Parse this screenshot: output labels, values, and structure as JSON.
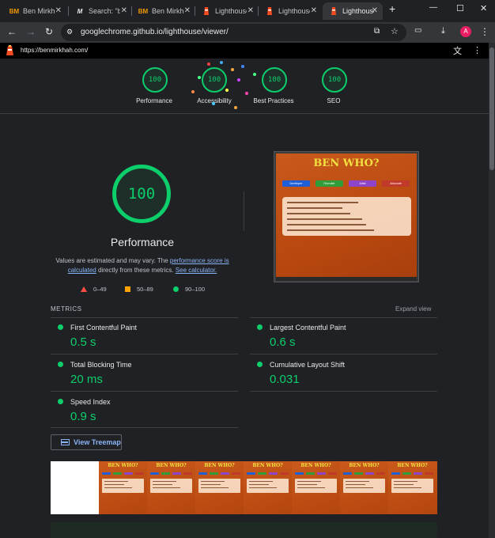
{
  "browser": {
    "tabs": [
      {
        "favicon": "BM",
        "title": "Ben Mirkhah",
        "active": false
      },
      {
        "favicon": "M",
        "title": "Search: \"b",
        "active": false
      },
      {
        "favicon": "BM",
        "title": "Ben Mirkh",
        "active": false
      },
      {
        "favicon": "lighthouse-icon",
        "title": "Lighthouse",
        "active": false
      },
      {
        "favicon": "lighthouse-icon",
        "title": "Lighthouse",
        "active": false
      },
      {
        "favicon": "lighthouse-icon",
        "title": "Lighthouse",
        "active": true
      }
    ],
    "new_tab": "+",
    "window_controls": {
      "minimize": "—",
      "maximize": "☐",
      "close": "✕"
    },
    "address": "googlechrome.github.io/lighthouse/viewer/",
    "profile_initial": "A",
    "accent_color": "#e91e63"
  },
  "lighthouse": {
    "report_url": "https://benmirkhah.com/",
    "summary_gauges": [
      {
        "label": "Performance",
        "score": "100"
      },
      {
        "label": "Accessibility",
        "score": "100"
      },
      {
        "label": "Best Practices",
        "score": "100"
      },
      {
        "label": "SEO",
        "score": "100"
      }
    ],
    "performance": {
      "score": "100",
      "title": "Performance",
      "note_prefix": "Values are estimated and may vary. The ",
      "note_link1": "performance score is calculated",
      "note_mid": " directly from these metrics. ",
      "note_link2": "See calculator.",
      "legend": [
        {
          "range": "0–49",
          "color": "#ff4e42",
          "shape": "triangle"
        },
        {
          "range": "50–89",
          "color": "#ffa400",
          "shape": "square"
        },
        {
          "range": "90–100",
          "color": "#0cce6b",
          "shape": "circle"
        }
      ]
    },
    "screenshot": {
      "site_title": "BEN WHO?",
      "buttons": [
        {
          "label": "Developer",
          "color": "#1e5fd8"
        },
        {
          "label": "Recruiter",
          "color": "#2f9e3a"
        },
        {
          "label": "Artist",
          "color": "#8e44c9"
        },
        {
          "label": "Advocate",
          "color": "#c0392b"
        }
      ]
    },
    "metrics_header": "METRICS",
    "expand_view": "Expand view",
    "metrics": [
      {
        "name": "First Contentful Paint",
        "value": "0.5 s"
      },
      {
        "name": "Largest Contentful Paint",
        "value": "0.6 s"
      },
      {
        "name": "Total Blocking Time",
        "value": "20 ms"
      },
      {
        "name": "Cumulative Layout Shift",
        "value": "0.031"
      },
      {
        "name": "Speed Index",
        "value": "0.9 s"
      }
    ],
    "treemap_button": "View Treemap",
    "pass_color": "#0cce6b"
  }
}
